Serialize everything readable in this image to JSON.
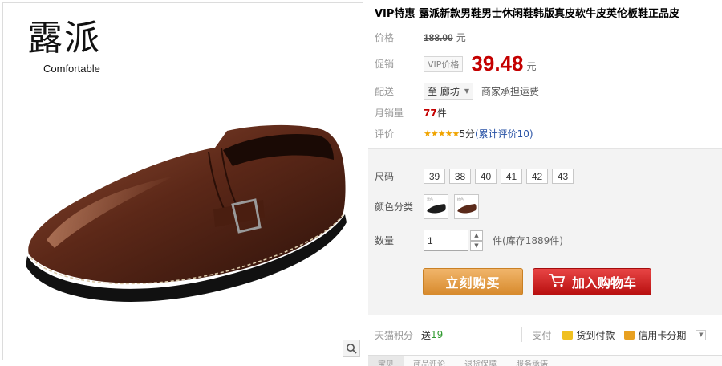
{
  "product_image": {
    "brand_logo_cn": "露派",
    "brand_logo_en": "Comfortable",
    "zoom_icon": "magnifier-icon"
  },
  "title": "VIP特惠 露派新款男鞋男士休闲鞋韩版真皮软牛皮英伦板鞋正品皮",
  "price": {
    "label": "价格",
    "list_price": "188.00",
    "unit": "元"
  },
  "promo": {
    "label": "促销",
    "badge": "VIP价格",
    "price": "39.48",
    "unit": "元"
  },
  "shipping": {
    "label": "配送",
    "selected": "至 廊坊",
    "note": "商家承担运费"
  },
  "monthly_sales": {
    "label": "月销量",
    "value": "77",
    "unit": "件"
  },
  "rating": {
    "label": "评价",
    "stars": "★★★★★",
    "score": "5分",
    "reviews_link": "(累计评价10)"
  },
  "options": {
    "size_label": "尺码",
    "sizes": [
      "39",
      "38",
      "40",
      "41",
      "42",
      "43"
    ],
    "color_label": "颜色分类",
    "color_swatch_labels": [
      "黑色",
      "棕色"
    ],
    "qty_label": "数量",
    "qty_value": "1",
    "qty_unit": "件",
    "stock_text": "(库存1889件)"
  },
  "actions": {
    "buy_now": "立刻购买",
    "add_to_cart": "加入购物车"
  },
  "bottom": {
    "points_label": "天猫积分",
    "points_prefix": "送",
    "points_value": "19",
    "pay_label": "支付",
    "cod": "货到付款",
    "installment": "信用卡分期"
  },
  "tabs": [
    "宝贝",
    "商品评论",
    "退货保障",
    "服务承诺"
  ],
  "colors": {
    "price_red": "#c40000",
    "buy_orange": "#e09a40",
    "cart_red": "#c81a1a",
    "link_blue": "#2953a6",
    "star_gold": "#f0a400",
    "green": "#2f9a2f"
  }
}
